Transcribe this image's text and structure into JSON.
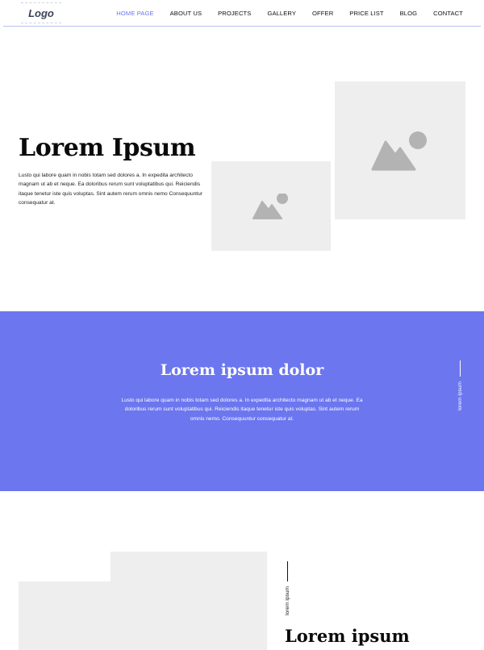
{
  "header": {
    "logo": "Logo",
    "nav": [
      {
        "label": "HOME PAGE",
        "active": true
      },
      {
        "label": "ABOUT US",
        "active": false
      },
      {
        "label": "PROJECTS",
        "active": false
      },
      {
        "label": "GALLERY",
        "active": false
      },
      {
        "label": "OFFER",
        "active": false
      },
      {
        "label": "PRICE LIST",
        "active": false
      },
      {
        "label": "BLOG",
        "active": false
      },
      {
        "label": "CONTACT",
        "active": false
      }
    ]
  },
  "hero": {
    "title": "Lorem Ipsum",
    "text": "Lusto qui labore quam in nobis totam sed dolores a. In expedita architecto magnam ut ab et neque. Ea doloribus rerum sunt voluptatibus qui. Reiciendis itaque tenetur iste quis voluptas. Sint autem rerum omnis nemo Consequuntur consequatur at.",
    "images": [
      {
        "icon": "image-placeholder-icon"
      },
      {
        "icon": "image-placeholder-icon"
      }
    ]
  },
  "band": {
    "title": "Lorem ipsum dolor",
    "text": "Lusto qui labore quam in nobis totam sed dolores a. In expedita architecto magnam ut ab et neque. Ea doloribus rerum sunt voluptatibus qui. Reiciendis itaque tenetur iste quis voluptas. Sint autem rerum omnis nemo. Consequuntur consequatur at.",
    "side_label": "lorem ipsum",
    "background": "#6b76ef"
  },
  "section3": {
    "side_label": "lorem ipsum",
    "title": "Lorem ipsum"
  },
  "colors": {
    "accent": "#6b77ee",
    "placeholder": "#eeeeee",
    "placeholder_icon": "#b3b3b3"
  }
}
